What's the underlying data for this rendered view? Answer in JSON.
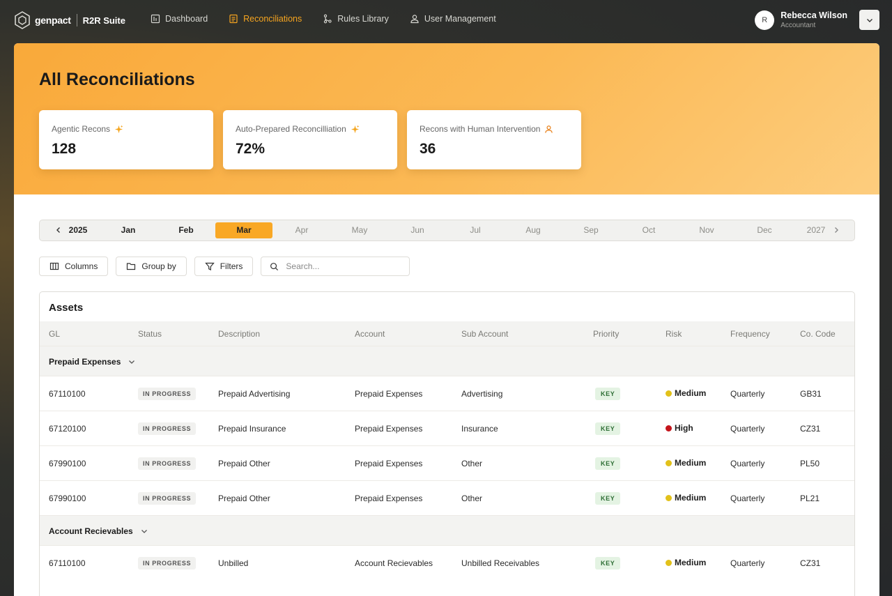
{
  "brand": {
    "logo_text": "genpact",
    "suite": "R2R Suite"
  },
  "nav": [
    {
      "label": "Dashboard",
      "icon": "dashboard-icon"
    },
    {
      "label": "Reconciliations",
      "icon": "document-icon",
      "active": true
    },
    {
      "label": "Rules Library",
      "icon": "branch-icon"
    },
    {
      "label": "User Management",
      "icon": "user-icon"
    }
  ],
  "user": {
    "initial": "R",
    "name": "Rebecca Wilson",
    "role": "Accountant"
  },
  "page": {
    "title": "All Reconciliations"
  },
  "stats": [
    {
      "label": "Agentic Recons",
      "value": "128",
      "icon": "sparkle-icon"
    },
    {
      "label": "Auto-Prepared Reconcilliation",
      "value": "72%",
      "icon": "sparkle-icon"
    },
    {
      "label": "Recons with Human Intervention",
      "value": "36",
      "icon": "person-icon"
    }
  ],
  "months": {
    "year_start": "2025",
    "year_end": "2027",
    "items": [
      "Jan",
      "Feb",
      "Mar",
      "Apr",
      "May",
      "Jun",
      "Jul",
      "Aug",
      "Sep",
      "Oct",
      "Nov",
      "Dec"
    ],
    "selected": "Mar"
  },
  "toolbar": {
    "columns_label": "Columns",
    "group_label": "Group by",
    "filters_label": "Filters",
    "search_placeholder": "Search..."
  },
  "table": {
    "title": "Assets",
    "headers": [
      "GL",
      "Status",
      "Description",
      "Account",
      "Sub Account",
      "Priority",
      "Risk",
      "Frequency",
      "Co. Code"
    ],
    "groups": [
      {
        "label": "Prepaid Expenses",
        "rows": [
          {
            "gl": "67110100",
            "status": "IN PROGRESS",
            "description": "Prepaid Advertising",
            "account": "Prepaid Expenses",
            "sub_account": "Advertising",
            "priority": "KEY",
            "risk": "Medium",
            "frequency": "Quarterly",
            "co_code": "GB31"
          },
          {
            "gl": "67120100",
            "status": "IN PROGRESS",
            "description": "Prepaid Insurance",
            "account": "Prepaid Expenses",
            "sub_account": "Insurance",
            "priority": "KEY",
            "risk": "High",
            "frequency": "Quarterly",
            "co_code": "CZ31"
          },
          {
            "gl": "67990100",
            "status": "IN PROGRESS",
            "description": "Prepaid Other",
            "account": "Prepaid Expenses",
            "sub_account": "Other",
            "priority": "KEY",
            "risk": "Medium",
            "frequency": "Quarterly",
            "co_code": "PL50"
          },
          {
            "gl": "67990100",
            "status": "IN PROGRESS",
            "description": "Prepaid Other",
            "account": "Prepaid Expenses",
            "sub_account": "Other",
            "priority": "KEY",
            "risk": "Medium",
            "frequency": "Quarterly",
            "co_code": "PL21"
          }
        ]
      },
      {
        "label": "Account Recievables",
        "rows": [
          {
            "gl": "67110100",
            "status": "IN PROGRESS",
            "description": "Unbilled",
            "account": "Account Recievables",
            "sub_account": "Unbilled Receivables",
            "priority": "KEY",
            "risk": "Medium",
            "frequency": "Quarterly",
            "co_code": "CZ31"
          }
        ]
      }
    ]
  },
  "colors": {
    "accent": "#f7a51f",
    "risk_medium": "#e2c11a",
    "risk_high": "#c4141b",
    "key_badge_bg": "#e4f3e3",
    "key_badge_text": "#2e6e35"
  }
}
